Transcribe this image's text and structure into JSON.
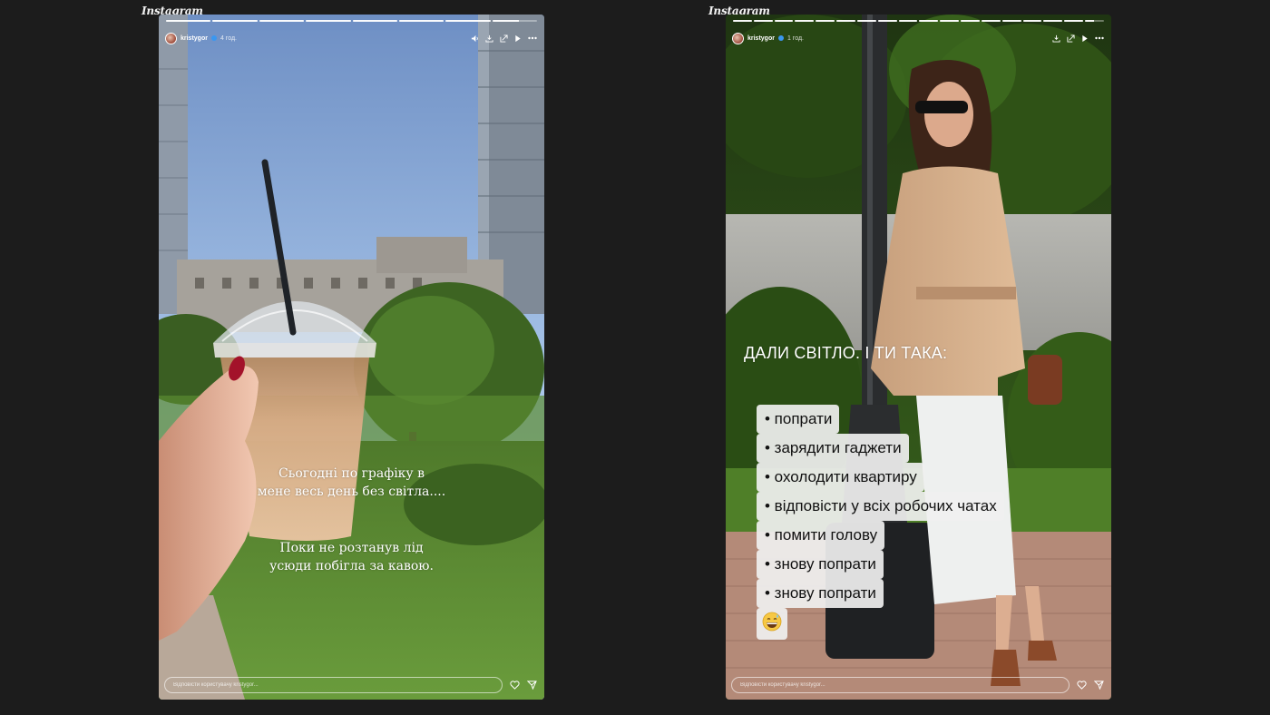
{
  "brand": "Instagram",
  "stories": [
    {
      "username": "kristygor",
      "time": "4 год.",
      "progress": [
        1,
        1,
        1,
        1,
        1,
        1,
        1,
        0.6
      ],
      "lines1": [
        "Сьогодні по графіку в",
        "мене весь день без світла...."
      ],
      "lines2": [
        "Поки не розтанув лід",
        "усюди побігла за кавою."
      ],
      "reply_placeholder": "Відповісти користувачу kristygor..."
    },
    {
      "username": "kristygor",
      "time": "1 год.",
      "progress": [
        1,
        1,
        1,
        1,
        1,
        1,
        1,
        1,
        1,
        1,
        1,
        1,
        1,
        1,
        1,
        1,
        1,
        0.5
      ],
      "headline": "ДАЛИ СВІТЛО. І ТИ ТАКА:",
      "todo": [
        "• попрати",
        "• зарядити гаджети",
        "• охолодити квартиру",
        "• відповісти у всіх робочих чатах",
        "• помити голову",
        "• знову попрати",
        "• знову попрати"
      ],
      "reply_placeholder": "Відповісти користувачу kristygor..."
    }
  ],
  "icons": {
    "header": [
      "mute-icon",
      "download-icon",
      "share-icon",
      "play-icon",
      "more-icon"
    ],
    "reply": [
      "heart-icon",
      "send-icon"
    ],
    "emoji": "grinning-sweat-emoji"
  }
}
